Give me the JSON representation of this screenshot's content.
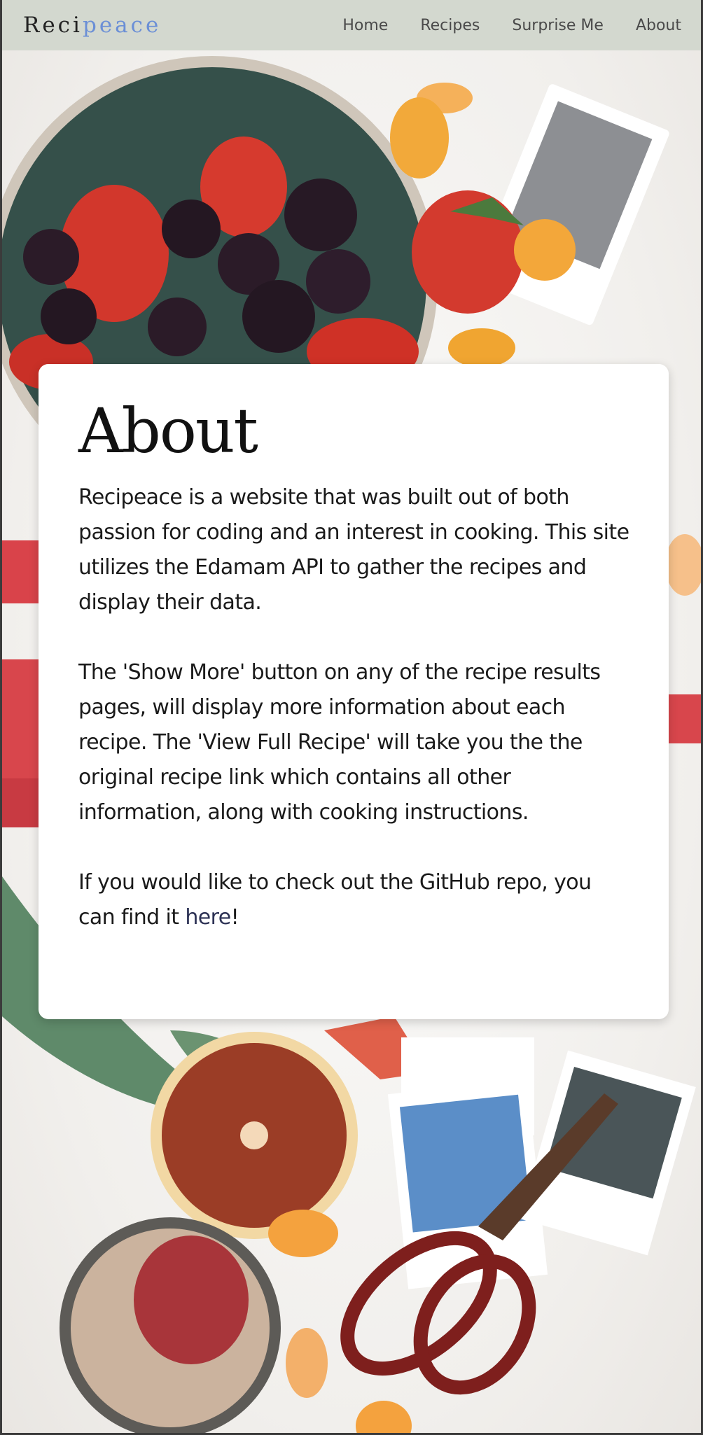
{
  "navbar": {
    "brand_part1": "Reci",
    "brand_part2": "peace",
    "links": [
      "Home",
      "Recipes",
      "Surprise Me",
      "About"
    ]
  },
  "about": {
    "title": "About",
    "paragraph1": "Recipeace is a website that was built out of both passion for coding and an interest in cooking. This site utilizes the Edamam API to gather the recipes and display their data.",
    "paragraph2": "The 'Show More' button on any of the recipe results pages, will display more information about each recipe. The 'View Full Recipe' will take you the the original recipe link which contains all other information, along with cooking instructions.",
    "paragraph3_before": "If you would like to check out the GitHub repo, you can find it ",
    "paragraph3_link": "here",
    "paragraph3_after": "!"
  },
  "colors": {
    "navbar_bg": "#d3d8cf",
    "brand_accent": "#6b8fd6",
    "link_color": "#2c3154",
    "card_bg": "#ffffff"
  }
}
